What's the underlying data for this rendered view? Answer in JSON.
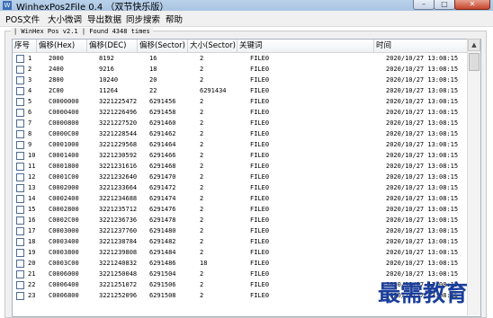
{
  "window": {
    "title": "WinhexPos2File  0.4 （双节快乐版）"
  },
  "menu": [
    "POS文件",
    "大小微调",
    "导出数据",
    "同步搜索",
    "帮助"
  ],
  "status_line": "| WinHex Pos v2.1 | Found 4348 times",
  "columns": [
    "序号",
    "偏移(Hex)",
    "偏移(DEC)",
    "偏移(Sector)",
    "大小(Sector)",
    "关键词",
    "时间"
  ],
  "rows": [
    [
      "1",
      "2000",
      "8192",
      "16",
      "2",
      "FILE0",
      "2020/10/27 13:08:15"
    ],
    [
      "2",
      "2400",
      "9216",
      "18",
      "2",
      "FILE0",
      "2020/10/27 13:08:15"
    ],
    [
      "3",
      "2800",
      "10240",
      "20",
      "2",
      "FILE0",
      "2020/10/27 13:08:15"
    ],
    [
      "4",
      "2C00",
      "11264",
      "22",
      "6291434",
      "FILE0",
      "2020/10/27 13:08:15"
    ],
    [
      "5",
      "C0000000",
      "3221225472",
      "6291456",
      "2",
      "FILE0",
      "2020/10/27 13:08:15"
    ],
    [
      "6",
      "C0000400",
      "3221226496",
      "6291458",
      "2",
      "FILE0",
      "2020/10/27 13:08:15"
    ],
    [
      "7",
      "C0000800",
      "3221227520",
      "6291460",
      "2",
      "FILE0",
      "2020/10/27 13:08:15"
    ],
    [
      "8",
      "C0000C00",
      "3221228544",
      "6291462",
      "2",
      "FILE0",
      "2020/10/27 13:08:15"
    ],
    [
      "9",
      "C0001000",
      "3221229568",
      "6291464",
      "2",
      "FILE0",
      "2020/10/27 13:08:15"
    ],
    [
      "10",
      "C0001400",
      "3221230592",
      "6291466",
      "2",
      "FILE0",
      "2020/10/27 13:08:15"
    ],
    [
      "11",
      "C0001800",
      "3221231616",
      "6291468",
      "2",
      "FILE0",
      "2020/10/27 13:08:15"
    ],
    [
      "12",
      "C0001C00",
      "3221232640",
      "6291470",
      "2",
      "FILE0",
      "2020/10/27 13:08:15"
    ],
    [
      "13",
      "C0002000",
      "3221233664",
      "6291472",
      "2",
      "FILE0",
      "2020/10/27 13:08:15"
    ],
    [
      "14",
      "C0002400",
      "3221234688",
      "6291474",
      "2",
      "FILE0",
      "2020/10/27 13:08:15"
    ],
    [
      "15",
      "C0002800",
      "3221235712",
      "6291476",
      "2",
      "FILE0",
      "2020/10/27 13:08:15"
    ],
    [
      "16",
      "C0002C00",
      "3221236736",
      "6291478",
      "2",
      "FILE0",
      "2020/10/27 13:08:15"
    ],
    [
      "17",
      "C0003000",
      "3221237760",
      "6291480",
      "2",
      "FILE0",
      "2020/10/27 13:08:15"
    ],
    [
      "18",
      "C0003400",
      "3221238784",
      "6291482",
      "2",
      "FILE0",
      "2020/10/27 13:08:15"
    ],
    [
      "19",
      "C0003800",
      "3221239808",
      "6291484",
      "2",
      "FILE0",
      "2020/10/27 13:08:15"
    ],
    [
      "20",
      "C0003C00",
      "3221240832",
      "6291486",
      "18",
      "FILE0",
      "2020/10/27 13:08:15"
    ],
    [
      "21",
      "C0006000",
      "3221250048",
      "6291504",
      "2",
      "FILE0",
      "2020/10/27 13:08:15"
    ],
    [
      "22",
      "C0006400",
      "3221251072",
      "6291506",
      "2",
      "FILE0",
      "2020/10/27 13:08:15"
    ],
    [
      "23",
      "C0006800",
      "3221252096",
      "6291508",
      "2",
      "FILE0",
      "2020/10/27 13:08:15"
    ]
  ],
  "watermark": "最需教育"
}
